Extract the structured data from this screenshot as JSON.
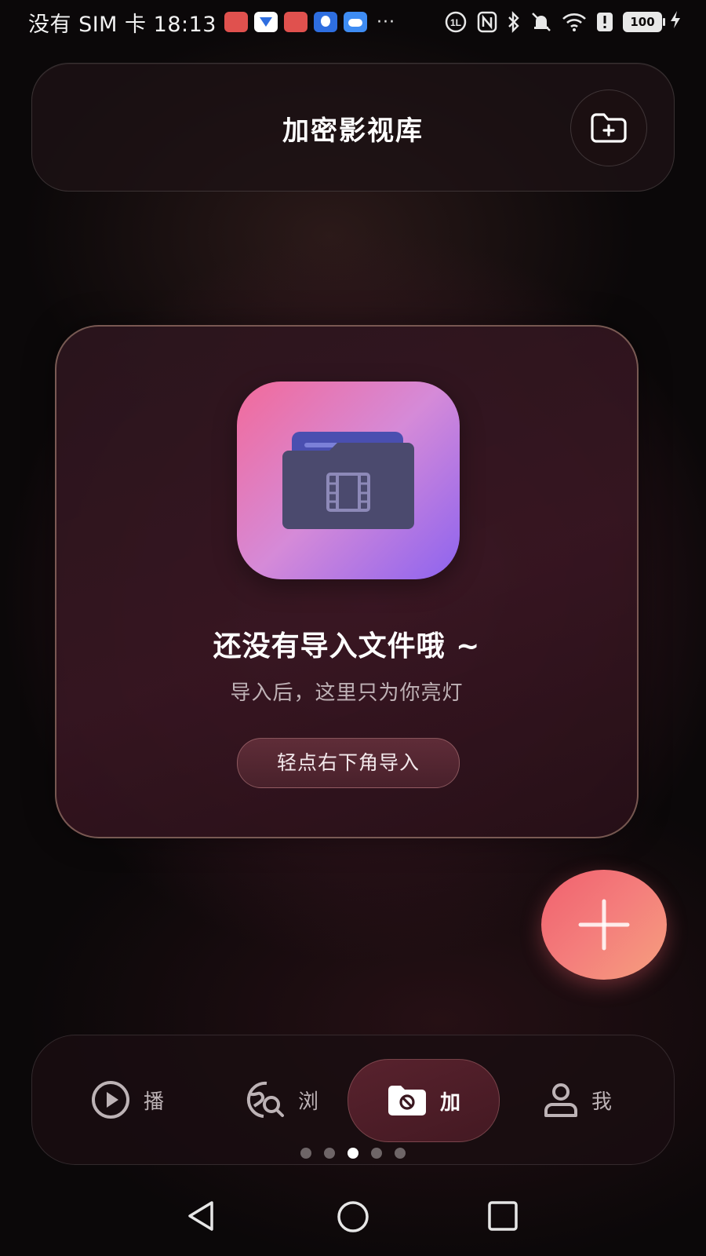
{
  "status_bar": {
    "carrier": "没有 SIM 卡",
    "time": "18:13",
    "more": "···",
    "battery": "100"
  },
  "header": {
    "title": "加密影视库"
  },
  "empty_state": {
    "title": "还没有导入文件哦 ~",
    "subtitle": "导入后，这里只为你亮灯",
    "hint_button": "轻点右下角导入"
  },
  "bottom_nav": {
    "items": [
      {
        "label": "播",
        "icon": "play-circle-icon",
        "active": false
      },
      {
        "label": "浏",
        "icon": "globe-search-icon",
        "active": false
      },
      {
        "label": "加",
        "icon": "hidden-folder-icon",
        "active": true
      },
      {
        "label": "我",
        "icon": "person-icon",
        "active": false
      }
    ]
  },
  "page_indicator": {
    "count": 5,
    "active_index": 2
  },
  "colors": {
    "background": "#0b0809",
    "fab_gradient_start": "#f0616e",
    "fab_gradient_end": "#f6a07e",
    "icon_gradient_start": "#f26a9a",
    "icon_gradient_end": "#8d63ef"
  }
}
